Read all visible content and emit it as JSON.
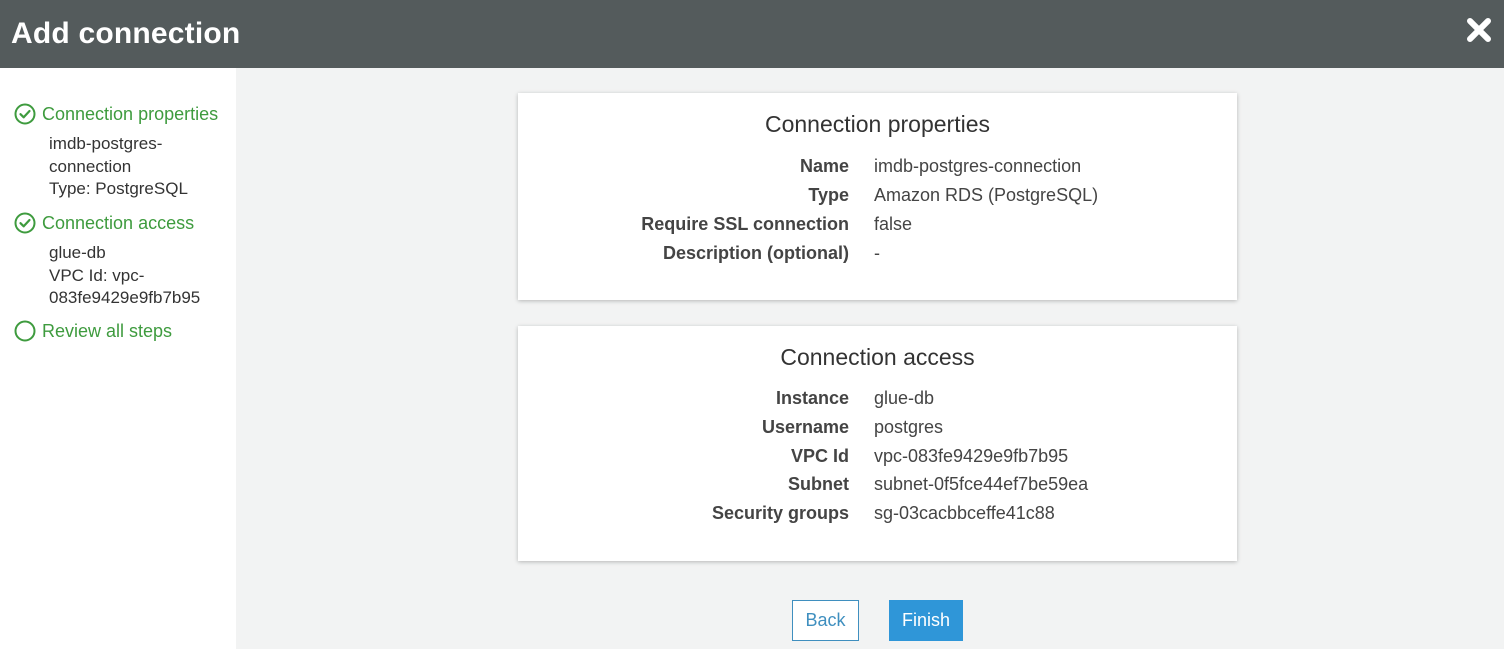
{
  "header": {
    "title": "Add connection",
    "close_icon": "close-x-icon"
  },
  "sidebar": {
    "steps": [
      {
        "label": "Connection properties",
        "status": "complete",
        "icon": "check-circle-icon",
        "details": [
          "imdb-postgres-",
          "connection",
          "Type: PostgreSQL"
        ]
      },
      {
        "label": "Connection access",
        "status": "complete",
        "icon": "check-circle-icon",
        "details": [
          "glue-db",
          "VPC Id: vpc-",
          "083fe9429e9fb7b95"
        ]
      },
      {
        "label": "Review all steps",
        "status": "current",
        "icon": "empty-circle-icon",
        "details": []
      }
    ]
  },
  "cards": [
    {
      "title": "Connection properties",
      "rows": [
        {
          "label": "Name",
          "value": "imdb-postgres-connection"
        },
        {
          "label": "Type",
          "value": "Amazon RDS (PostgreSQL)"
        },
        {
          "label": "Require SSL connection",
          "value": "false"
        },
        {
          "label": "Description (optional)",
          "value": "-"
        }
      ]
    },
    {
      "title": "Connection access",
      "rows": [
        {
          "label": "Instance",
          "value": "glue-db"
        },
        {
          "label": "Username",
          "value": "postgres"
        },
        {
          "label": "VPC Id",
          "value": "vpc-083fe9429e9fb7b95"
        },
        {
          "label": "Subnet",
          "value": "subnet-0f5fce44ef7be59ea"
        },
        {
          "label": "Security groups",
          "value": "sg-03cacbbceffe41c88"
        }
      ]
    }
  ],
  "footer": {
    "back_label": "Back",
    "finish_label": "Finish"
  },
  "colors": {
    "header_bg": "#545b5c",
    "step_green": "#3e9b3e",
    "primary_blue": "#2f96d8"
  }
}
